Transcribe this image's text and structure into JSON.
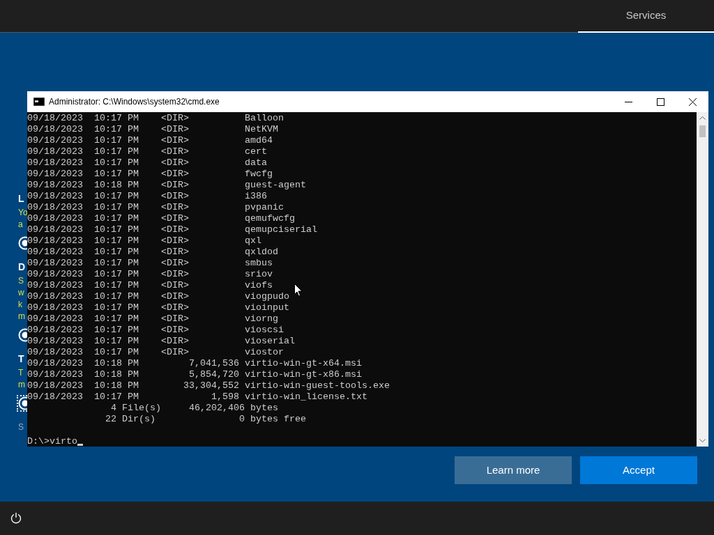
{
  "top_bar": {
    "tabs": [
      {
        "label": "Services",
        "selected": true
      }
    ]
  },
  "background_panel": {
    "sections": [
      {
        "heading": "L",
        "lines": [
          "Yo",
          "a"
        ],
        "focused": false
      },
      {
        "heading": "D",
        "lines": [
          "S",
          "w",
          "k",
          "m"
        ],
        "focused": false
      },
      {
        "heading": "T",
        "lines": [
          "T",
          "m"
        ],
        "focused": true
      }
    ],
    "footer": "S"
  },
  "console": {
    "title": "Administrator: C:\\Windows\\system32\\cmd.exe",
    "lines": [
      "09/18/2023  10:17 PM    <DIR>          Balloon",
      "09/18/2023  10:17 PM    <DIR>          NetKVM",
      "09/18/2023  10:17 PM    <DIR>          amd64",
      "09/18/2023  10:17 PM    <DIR>          cert",
      "09/18/2023  10:17 PM    <DIR>          data",
      "09/18/2023  10:17 PM    <DIR>          fwcfg",
      "09/18/2023  10:18 PM    <DIR>          guest-agent",
      "09/18/2023  10:17 PM    <DIR>          i386",
      "09/18/2023  10:17 PM    <DIR>          pvpanic",
      "09/18/2023  10:17 PM    <DIR>          qemufwcfg",
      "09/18/2023  10:17 PM    <DIR>          qemupciserial",
      "09/18/2023  10:17 PM    <DIR>          qxl",
      "09/18/2023  10:17 PM    <DIR>          qxldod",
      "09/18/2023  10:17 PM    <DIR>          smbus",
      "09/18/2023  10:17 PM    <DIR>          sriov",
      "09/18/2023  10:17 PM    <DIR>          viofs",
      "09/18/2023  10:17 PM    <DIR>          viogpudo",
      "09/18/2023  10:17 PM    <DIR>          vioinput",
      "09/18/2023  10:17 PM    <DIR>          viorng",
      "09/18/2023  10:17 PM    <DIR>          vioscsi",
      "09/18/2023  10:17 PM    <DIR>          vioserial",
      "09/18/2023  10:17 PM    <DIR>          viostor",
      "09/18/2023  10:18 PM         7,041,536 virtio-win-gt-x64.msi",
      "09/18/2023  10:18 PM         5,854,720 virtio-win-gt-x86.msi",
      "09/18/2023  10:18 PM        33,304,552 virtio-win-guest-tools.exe",
      "09/18/2023  10:17 PM             1,598 virtio-win_license.txt",
      "               4 File(s)     46,202,406 bytes",
      "              22 Dir(s)               0 bytes free"
    ],
    "prompt": "D:\\>virto"
  },
  "buttons": [
    {
      "label": "Learn more",
      "kind": "secondary"
    },
    {
      "label": "Accept",
      "kind": "primary"
    }
  ]
}
